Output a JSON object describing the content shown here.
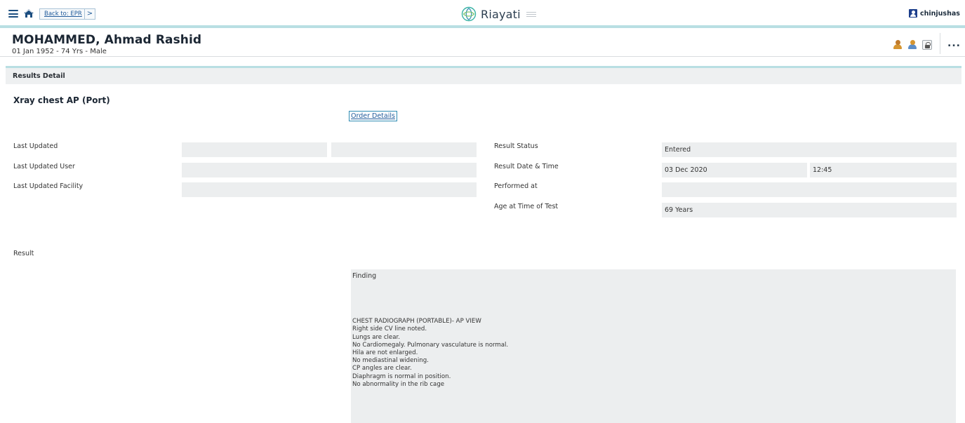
{
  "topbar": {
    "back_label": "Back to: EPR",
    "back_arrow": ">",
    "brand_name": "Riayati",
    "user_name": "chinjushas"
  },
  "patient": {
    "name": "MOHAMMED, Ahmad Rashid",
    "info": "01 Jan 1952 - 74 Yrs - Male",
    "more": "..."
  },
  "section": {
    "title": "Results Detail"
  },
  "test": {
    "title": "Xray chest AP (Port)",
    "order_link": "Order Details"
  },
  "fields_left": {
    "last_updated": "Last Updated",
    "last_updated_user": "Last Updated User",
    "last_updated_facility": "Last Updated Facility"
  },
  "fields_right": {
    "result_status_label": "Result Status",
    "result_status_value": "Entered",
    "result_datetime_label": "Result Date & Time",
    "result_date": "03 Dec 2020",
    "result_time": "12:45",
    "performed_at_label": "Performed at",
    "age_label": "Age at Time of Test",
    "age_value": "69 Years"
  },
  "result": {
    "label": "Result",
    "finding": "Finding",
    "lines": [
      "CHEST RADIOGRAPH (PORTABLE)- AP VIEW",
      "Right side CV line  noted.",
      "Lungs are clear.",
      "No Cardiomegaly. Pulmonary vasculature is normal.",
      "Hila are not enlarged.",
      "No mediastinal widening.",
      "CP angles are clear.",
      "Diaphragm is normal in position.",
      "No abnormality in the rib cage"
    ]
  }
}
